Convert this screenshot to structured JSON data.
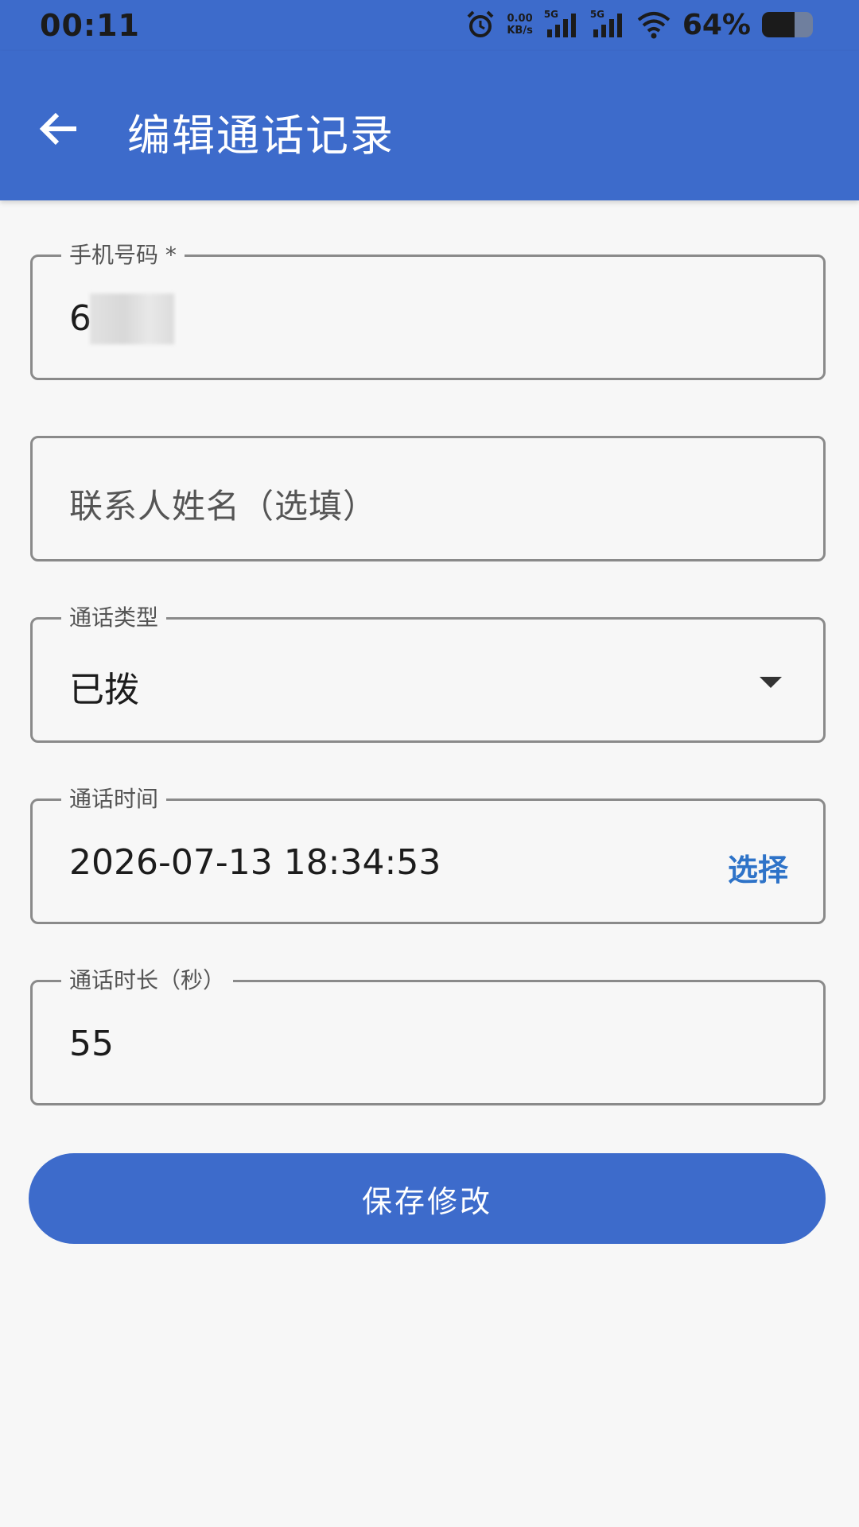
{
  "status_bar": {
    "time": "00:11",
    "net_speed_value": "0.00",
    "net_speed_unit": "KB/s",
    "signal1_tag": "5G",
    "signal2_tag": "5G",
    "battery_text": "64%",
    "battery_level": 0.64
  },
  "app_bar": {
    "title": "编辑通话记录",
    "back_icon": "arrow-left-icon"
  },
  "form": {
    "phone": {
      "label": "手机号码 *",
      "value": "6"
    },
    "contact": {
      "placeholder": "联系人姓名（选填）"
    },
    "call_type": {
      "label": "通话类型",
      "value": "已拨"
    },
    "call_time": {
      "label": "通话时间",
      "value": "2026-07-13 18:34:53",
      "select_label": "选择"
    },
    "duration": {
      "label": "通话时长（秒）",
      "value": "55"
    }
  },
  "save_button": {
    "label": "保存修改"
  },
  "colors": {
    "primary": "#3d6bcb",
    "link": "#2e73c8",
    "background": "#f7f7f7"
  }
}
